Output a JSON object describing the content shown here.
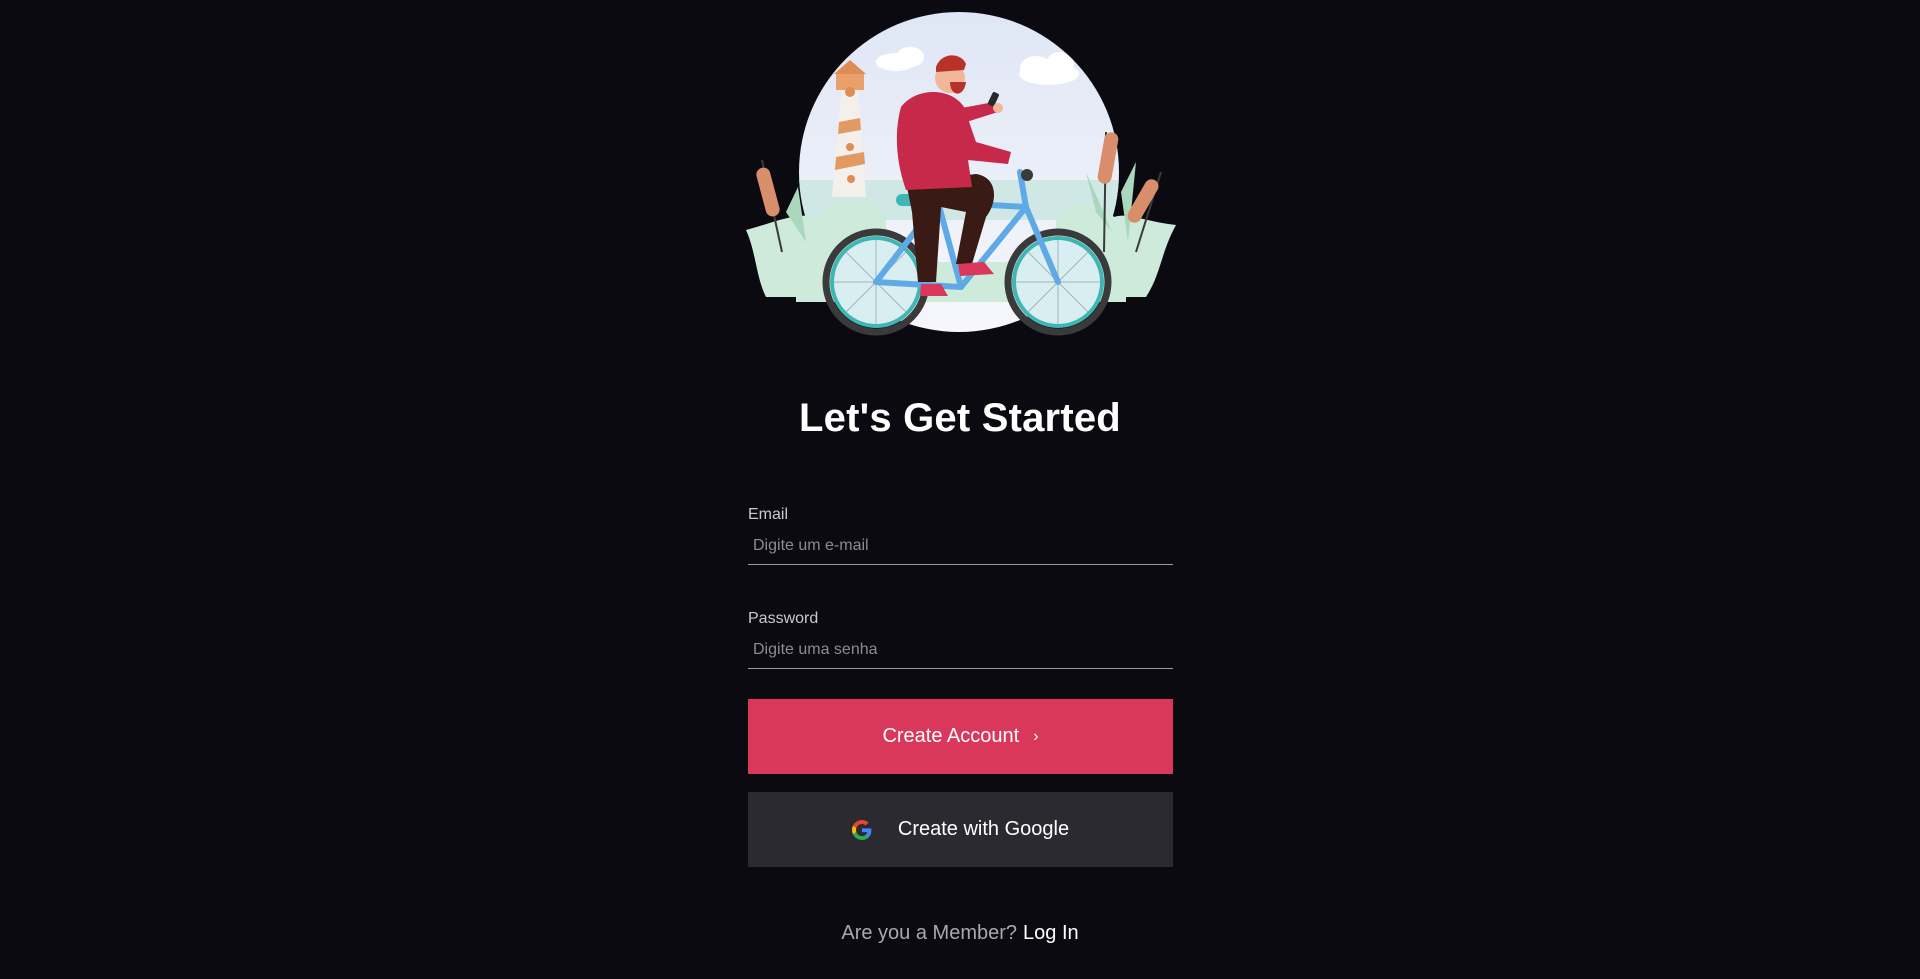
{
  "title": "Let's Get Started",
  "email": {
    "label": "Email",
    "placeholder": "Digite um e-mail"
  },
  "password": {
    "label": "Password",
    "placeholder": "Digite uma senha"
  },
  "create_button": {
    "label": "Create Account",
    "icon": "chevron-right-icon"
  },
  "google_button": {
    "label": "Create with Google",
    "icon": "google-icon"
  },
  "footer": {
    "prompt": "Are you a Member?",
    "link": "Log In"
  },
  "colors": {
    "background": "#0b0a10",
    "primary": "#d9385a",
    "secondary_button": "#2b2a30"
  }
}
